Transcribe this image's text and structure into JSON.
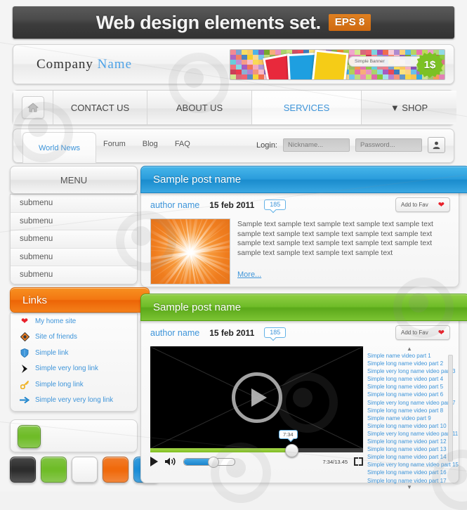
{
  "header": {
    "title": "Web design elements set.",
    "eps_badge": "EPS 8"
  },
  "company": {
    "name_first": "Company",
    "name_second": "Name"
  },
  "banner": {
    "label": "Simple Banner",
    "price_badge": "1$"
  },
  "mainnav": {
    "home_icon": "home-icon",
    "items": [
      {
        "label": "CONTACT US",
        "active": false
      },
      {
        "label": "ABOUT US",
        "active": false
      },
      {
        "label": "SERVICES",
        "active": true
      },
      {
        "label": "▼ SHOP",
        "active": false
      }
    ]
  },
  "tabbar": {
    "selected_tab": "World News",
    "tabs": [
      "Forum",
      "Blog",
      "FAQ"
    ],
    "login_label": "Login:",
    "nickname_placeholder": "Nickname...",
    "password_placeholder": "Password...",
    "user_icon": "user-icon"
  },
  "sidebar": {
    "menu_title": "MENU",
    "submenu_items": [
      "submenu",
      "submenu",
      "submenu",
      "submenu",
      "submenu"
    ],
    "links_title": "Links",
    "links": [
      {
        "label": "My home site",
        "icon": "heart-icon"
      },
      {
        "label": "Site of friends",
        "icon": "diamond-icon"
      },
      {
        "label": "Simple link",
        "icon": "shield-icon"
      },
      {
        "label": "Simple very long link",
        "icon": "play-arrow-icon"
      },
      {
        "label": "Simple long link",
        "icon": "key-icon"
      },
      {
        "label": "Simple very very long link",
        "icon": "arrow-right-icon"
      }
    ],
    "swatch_colors": [
      "#2d2d2d",
      "#6fbc28",
      "#ffffff",
      "#f06a0c",
      "#1b8ed8"
    ],
    "selected_swatch": "#6fbc28"
  },
  "post_blue": {
    "title": "Sample post name",
    "author": "author name",
    "date": "15 feb 2011",
    "comments": "185",
    "fav_label": "Add to Fav",
    "heart_icon": "heart-icon",
    "body": "Sample text sample text sample text sample text sample text sample text sample text sample text sample text sample text sample text sample text sample text sample text sample text sample text sample text sample text sample text",
    "more_label": "More...",
    "thumb_icon": "sunburst-image"
  },
  "post_green": {
    "title": "Sample post name",
    "author": "author name",
    "date": "15 feb 2011",
    "comments": "185",
    "fav_label": "Add to Fav",
    "heart_icon": "heart-icon",
    "video": {
      "play_icon": "play-icon",
      "volume_icon": "volume-icon",
      "fullscreen_icon": "fullscreen-icon",
      "tooltip_time": "7:34",
      "time_display": "7:34/13.45"
    },
    "playlist": [
      "Simple name video part 1",
      "Simple long name video part 2",
      "Simple very long name video part 3",
      "Simple long name video part 4",
      "Simple long name video part 5",
      "Simple long name video part 6",
      "Simple very long name video part 7",
      "Simple long name video part 8",
      "Simple name video part 9",
      "Simple long name video part 10",
      "Simple very long name video part 11",
      "Simple long name video part 12",
      "Simple long name video part 13",
      "Simple long name video part 14",
      "Simple very long name video part 15",
      "Simple long name video part 16",
      "Simple long name video part 17"
    ],
    "playlist_up": "▲",
    "playlist_down": "▼"
  },
  "colors": {
    "accent_blue": "#3d94d9",
    "accent_orange": "#f37712",
    "accent_green": "#6fbc28",
    "eps_orange": "#d7720f",
    "heart_red": "#e8212b"
  }
}
